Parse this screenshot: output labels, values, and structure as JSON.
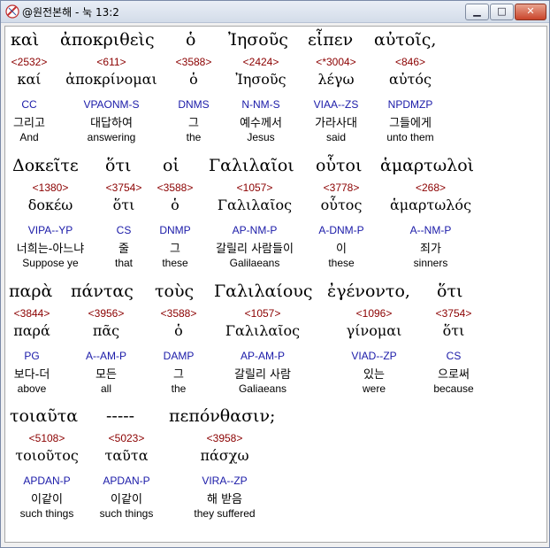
{
  "window": {
    "title": "@원전본해 - 눅 13:2"
  },
  "title_buttons": {
    "minimize": "▁",
    "maximize": "□",
    "close": "✕"
  },
  "line1": {
    "greek": [
      "καὶ",
      "ἀποκριθεὶς",
      "ὁ",
      "Ἰησοῦς",
      "εἶπεν",
      "αὐτοῖς,"
    ],
    "strongs": [
      "<2532>",
      "<611>",
      "<3588>",
      "<2424>",
      "<*3004>",
      "<846>"
    ],
    "lexeme": [
      "καί",
      "ἀποκρίνομαι",
      "ὁ",
      "Ἰησοῦς",
      "λέγω",
      "αὐτός"
    ],
    "morph": [
      "CC",
      "VPAONM-S",
      "DNMS",
      "N-NM-S",
      "VIAA--ZS",
      "NPDMZP"
    ],
    "korean": [
      "그리고",
      "대답하여",
      "그",
      "예수께서",
      "가라사대",
      "그들에게"
    ],
    "english": [
      "And",
      "answering",
      "the",
      "Jesus",
      "said",
      "unto them"
    ]
  },
  "line2": {
    "greek": [
      "Δοκεῖτε",
      "ὅτι",
      "οἱ",
      "Γαλιλαῖοι",
      "οὗτοι",
      "ἁμαρτωλοὶ"
    ],
    "strongs": [
      "<1380>",
      "<3754>",
      "<3588>",
      "<1057>",
      "<3778>",
      "<268>"
    ],
    "lexeme": [
      "δοκέω",
      "ὅτι",
      "ὁ",
      "Γαλιλαῖος",
      "οὗτος",
      "ἁμαρτωλός"
    ],
    "morph": [
      "VIPA--YP",
      "CS",
      "DNMP",
      "AP-NM-P",
      "A-DNM-P",
      "A--NM-P"
    ],
    "korean": [
      "너희는-아느냐",
      "줄",
      "그",
      "갈릴리 사람들이",
      "이",
      "죄가"
    ],
    "english": [
      "Suppose ye",
      "that",
      "these",
      "Galilaeans",
      "these",
      "sinners"
    ]
  },
  "line3": {
    "greek": [
      "παρὰ",
      "πάντας",
      "τοὺς",
      "Γαλιλαίους",
      "ἐγένοντο,",
      "ὅτι"
    ],
    "strongs": [
      "<3844>",
      "<3956>",
      "<3588>",
      "<1057>",
      "<1096>",
      "<3754>"
    ],
    "lexeme": [
      "παρά",
      "πᾶς",
      "ὁ",
      "Γαλιλαῖος",
      "γίνομαι",
      "ὅτι"
    ],
    "morph": [
      "PG",
      "A--AM-P",
      "DAMP",
      "AP-AM-P",
      "VIAD--ZP",
      "CS"
    ],
    "korean": [
      "보다-더",
      "모든",
      "그",
      "갈릴리 사람",
      "있는",
      "으로써"
    ],
    "english": [
      "above",
      "all",
      "the",
      "Galiaeans",
      "were",
      "because"
    ]
  },
  "line4": {
    "greek": [
      "τοιαῦτα",
      "-----",
      "πεπόνθασιν;"
    ],
    "strongs": [
      "<5108>",
      "<5023>",
      "<3958>"
    ],
    "lexeme": [
      "τοιοῦτος",
      "ταῦτα",
      "πάσχω"
    ],
    "morph": [
      "APDAN-P",
      "APDAN-P",
      "VIRA--ZP"
    ],
    "korean": [
      "이같이",
      "이같이",
      "해 받음"
    ],
    "english": [
      "such things",
      "such things",
      "they suffered"
    ]
  }
}
